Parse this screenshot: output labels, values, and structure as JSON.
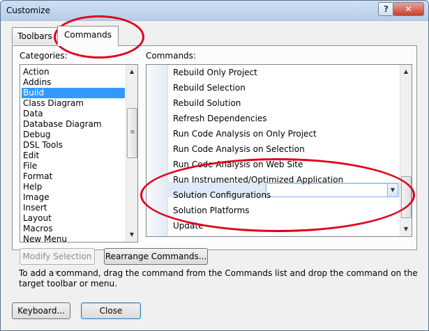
{
  "window": {
    "title": "Customize",
    "help_label": "?",
    "close_label": "✕"
  },
  "tabs": [
    {
      "label": "Toolbars"
    },
    {
      "label": "Commands"
    }
  ],
  "categories": {
    "label": "Categories:",
    "items": [
      "Action",
      "Addins",
      "Build",
      "Class Diagram",
      "Data",
      "Database Diagram",
      "Debug",
      "DSL Tools",
      "Edit",
      "File",
      "Format",
      "Help",
      "Image",
      "Insert",
      "Layout",
      "Macros",
      "New Menu"
    ],
    "selected": "Build"
  },
  "commands": {
    "label": "Commands:",
    "items": [
      "Rebuild Only Project",
      "Rebuild Selection",
      "Rebuild Solution",
      "Refresh Dependencies",
      "Run Code Analysis on Only Project",
      "Run Code Analysis on Selection",
      "Run Code Analysis on Web Site",
      "Run Instrumented/Optimized Application",
      "Solution Configurations",
      "Solution Platforms",
      "Update"
    ],
    "selected": "Solution Configurations",
    "combo_value": ""
  },
  "buttons": {
    "modify_selection": "Modify Selection",
    "rearrange": "Rearrange Commands...",
    "keyboard": "Keyboard...",
    "close": "Close"
  },
  "hint": "To add a command, drag the command from the Commands list and drop the command on the target toolbar or menu.",
  "colors": {
    "selection": "#3399ff",
    "annotation": "#e0001b"
  }
}
